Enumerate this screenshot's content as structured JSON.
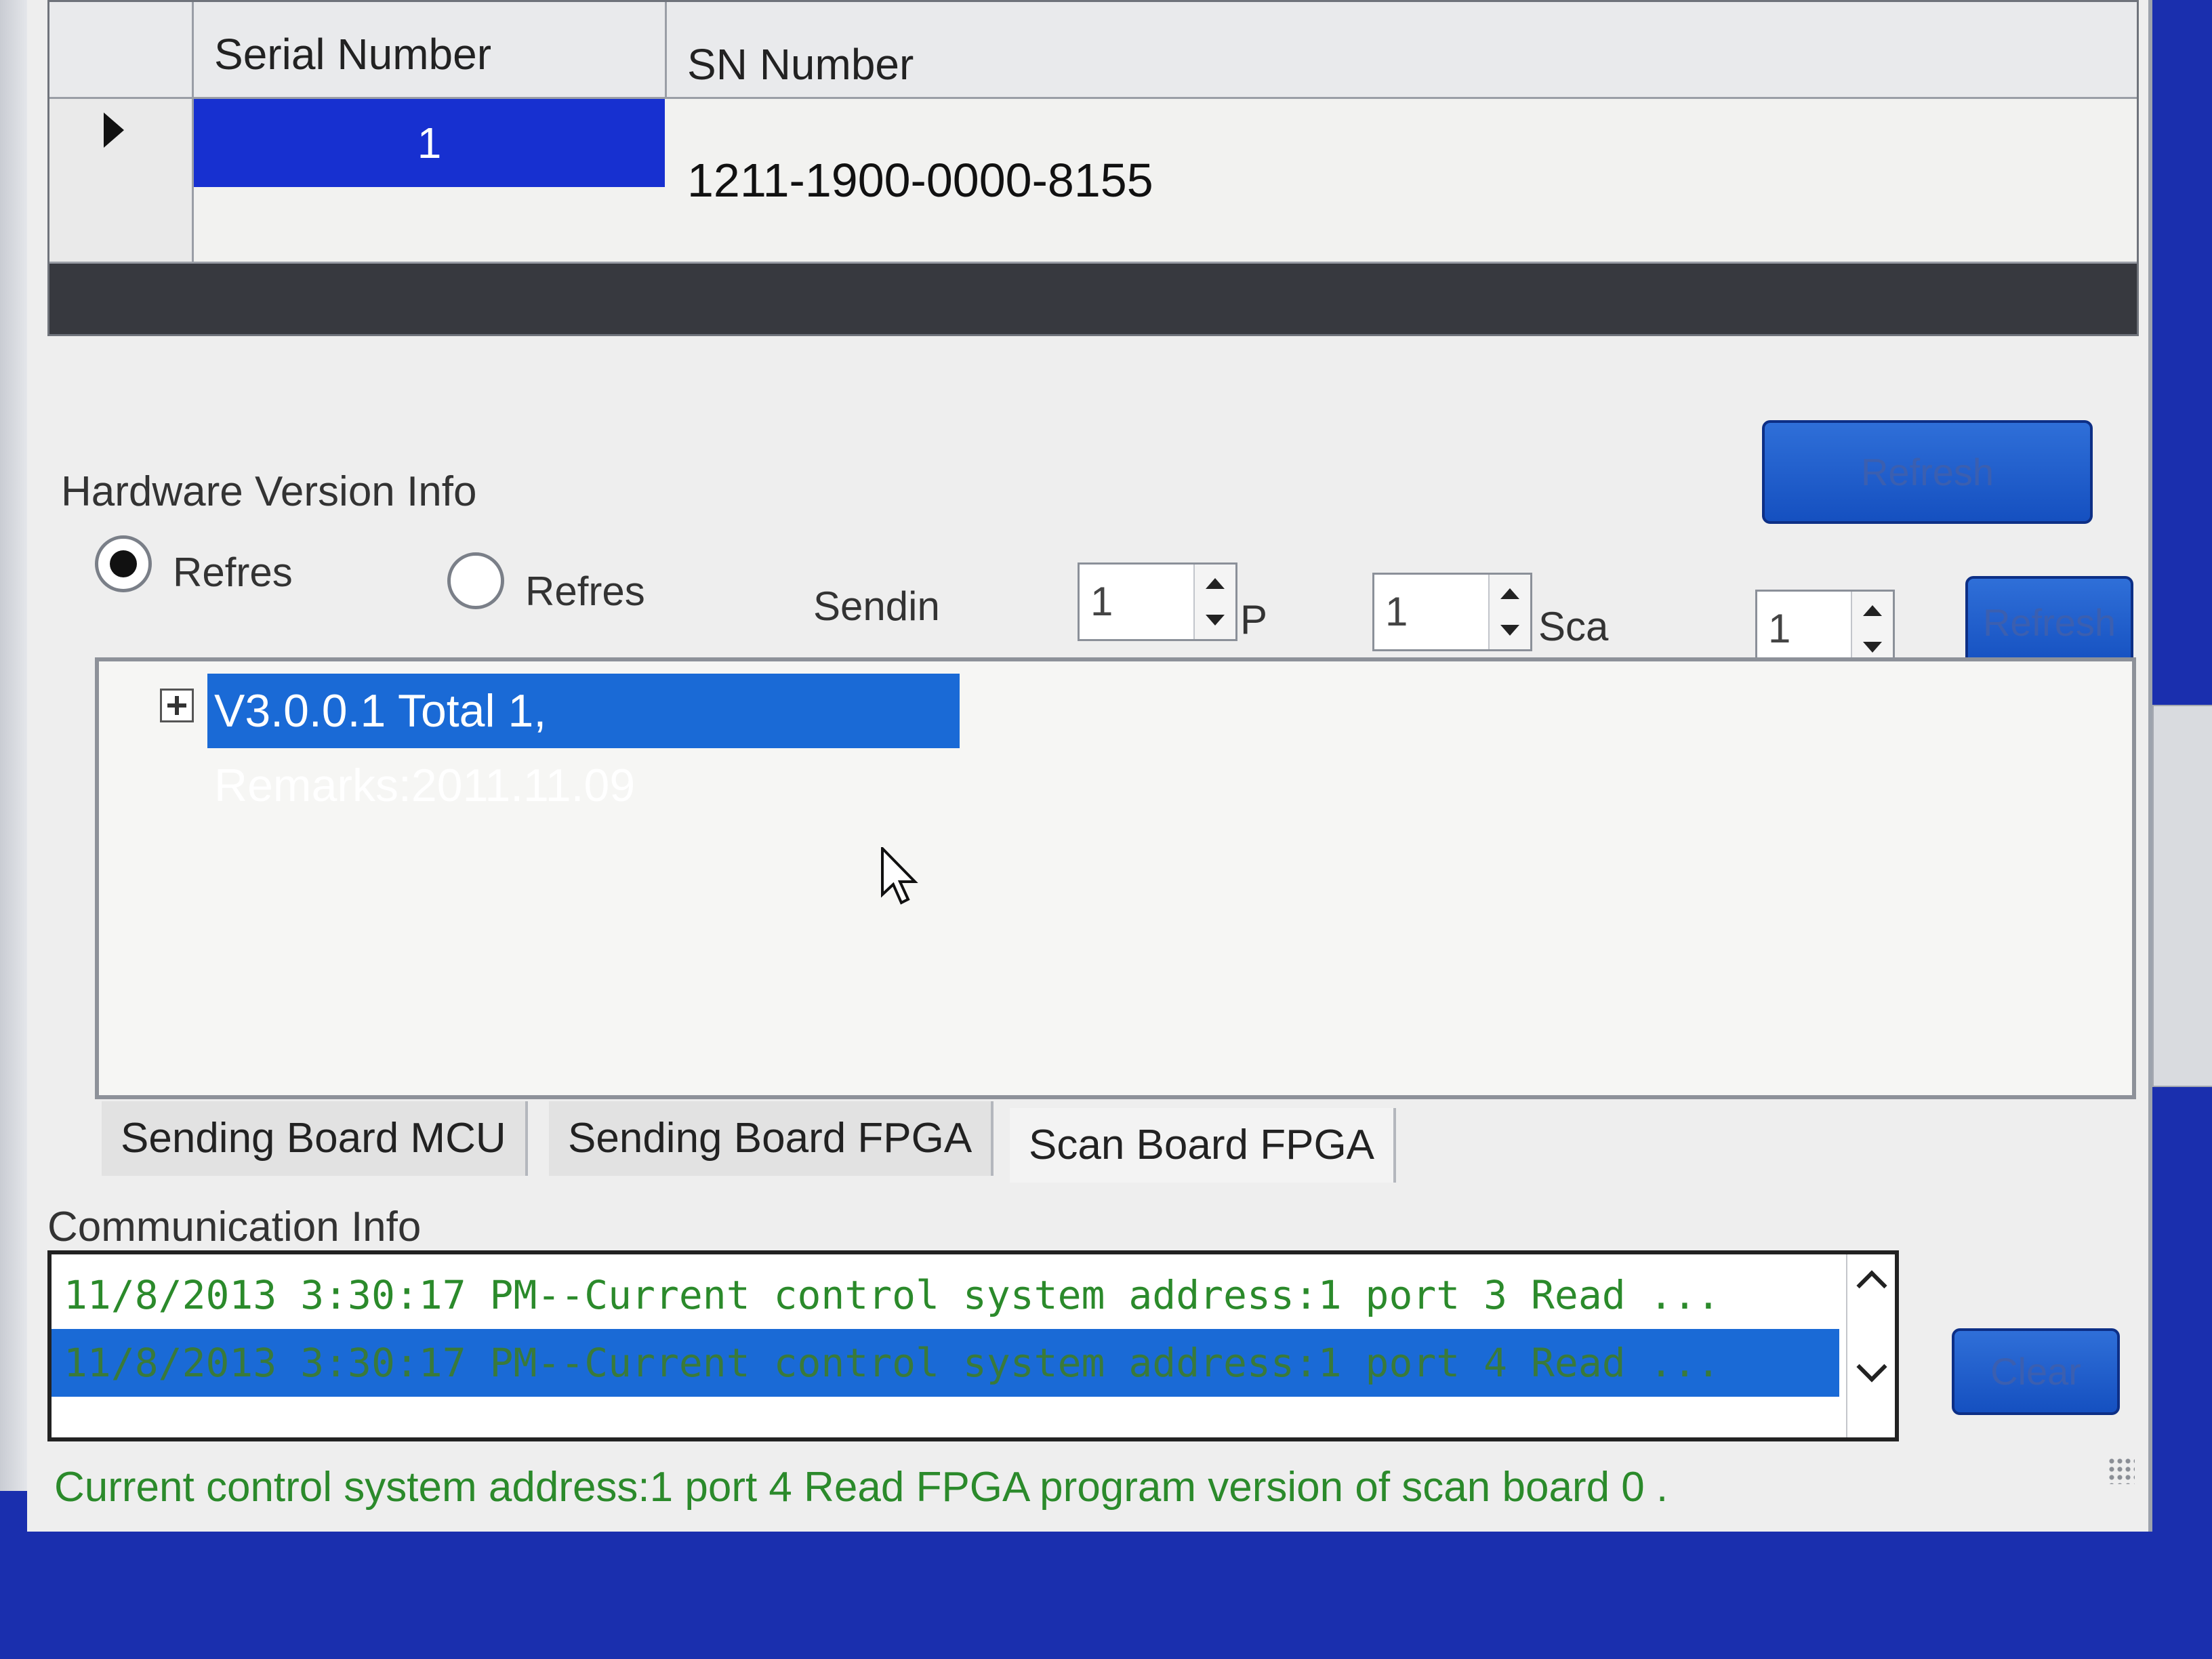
{
  "sn_grid": {
    "columns": [
      "Serial Number",
      "SN Number"
    ],
    "rows": [
      {
        "serial": "1",
        "sn": "1211-1900-0000-8155"
      }
    ]
  },
  "buttons": {
    "refresh_top": "Refresh",
    "refresh_hw": "Refresh",
    "clear": "Clear"
  },
  "hardware": {
    "title": "Hardware Version Info",
    "radio1_label": "Refres",
    "radio2_label": "Refres",
    "sending_label": "Sendin",
    "sending_value": "1",
    "port_label": "P",
    "port_value": "1",
    "scan_label": "Sca",
    "scan_value": "1",
    "tree_node": "V3.0.0.1 Total 1, Remarks:2011.11.09",
    "tabs": [
      "Sending Board MCU",
      "Sending Board FPGA",
      "Scan Board FPGA"
    ]
  },
  "communication": {
    "title": "Communication Info",
    "lines": [
      "11/8/2013 3:30:17 PM--Current control system address:1 port 3 Read ...",
      "11/8/2013 3:30:17 PM--Current control system address:1 port 4 Read ..."
    ]
  },
  "status_text": "Current control system address:1 port 4 Read FPGA program version of scan board 0 ."
}
